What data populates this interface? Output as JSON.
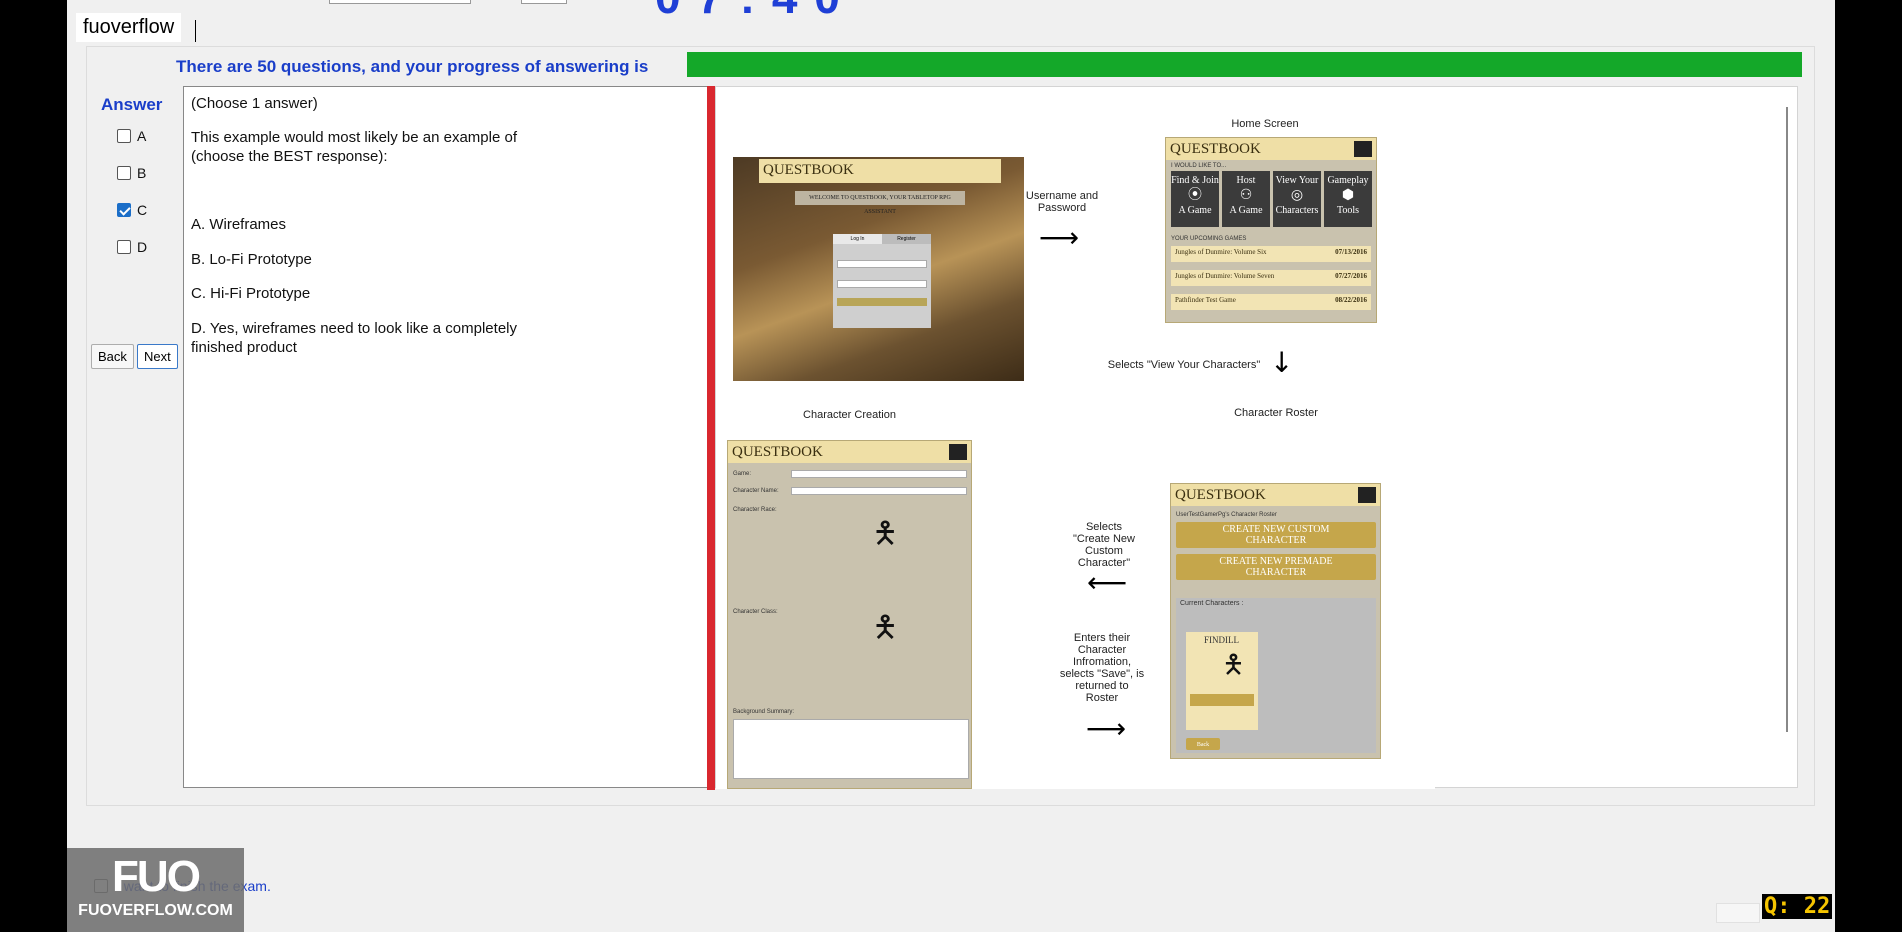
{
  "app": {
    "brand": "fuoverflow",
    "timer": "0 7 : 4 0"
  },
  "progress": {
    "text": "There are 50 questions, and your progress of answering is",
    "fraction": 1.0,
    "color": "#14a829"
  },
  "answer": {
    "title": "Answer",
    "options": [
      {
        "key": "A",
        "checked": false
      },
      {
        "key": "B",
        "checked": false
      },
      {
        "key": "C",
        "checked": true
      },
      {
        "key": "D",
        "checked": false
      }
    ],
    "back_label": "Back",
    "next_label": "Next"
  },
  "question": {
    "instruction": "(Choose 1 answer)",
    "stem_line1": "This example would most likely be an example of",
    "stem_line2": "(choose the BEST response):",
    "choices": [
      {
        "line1": "A.  Wireframes",
        "line2": ""
      },
      {
        "line1": "B.  Lo-Fi Prototype",
        "line2": ""
      },
      {
        "line1": "C.  Hi-Fi Prototype",
        "line2": ""
      },
      {
        "line1": "D.  Yes, wireframes need to look like a completely",
        "line2": "finished product"
      }
    ]
  },
  "figure": {
    "home_screen": "Home Screen",
    "username_password": "Username and Password",
    "selects_view": "Selects \"View Your Characters\"",
    "character_creation": "Character Creation",
    "character_roster": "Character Roster",
    "selects_create_l1": "Selects",
    "selects_create_l2": "\"Create New",
    "selects_create_l3": "Custom",
    "selects_create_l4": "Character\"",
    "enters_l1": "Enters their",
    "enters_l2": "Character",
    "enters_l3": "Infromation,",
    "enters_l4": "selects \"Save\", is",
    "enters_l5": "returned to",
    "enters_l6": "Roster",
    "questbook": "QUESTBOOK",
    "welcome": "WELCOME TO QUESTBOOK, YOUR TABLETOP RPG ASSISTANT",
    "log_in": "Log In",
    "register": "Register",
    "i_would_like": "I WOULD LIKE TO...",
    "tiles": [
      {
        "t1": "Find & Join",
        "t2": "A Game",
        "icon": "compass-icon",
        "glyph": "⦿"
      },
      {
        "t1": "Host",
        "t2": "A Game",
        "icon": "group-icon",
        "glyph": "⚇"
      },
      {
        "t1": "View Your",
        "t2": "Characters",
        "icon": "target-icon",
        "glyph": "◎"
      },
      {
        "t1": "Gameplay",
        "t2": "Tools",
        "icon": "dice-icon",
        "glyph": "⬢"
      }
    ],
    "upcoming": "YOUR UPCOMING GAMES",
    "games": [
      {
        "name": "Jungles of Dunmire: Volume Six",
        "date": "07/13/2016"
      },
      {
        "name": "Jungles of Dunmire: Volume Seven",
        "date": "07/27/2016"
      },
      {
        "name": "Pathfinder Test Game",
        "date": "08/22/2016"
      }
    ],
    "game_label": "Game:",
    "char_name_label": "Character Name:",
    "char_race_label": "Character Race:",
    "char_class_label": "Character Class:",
    "background_label": "Background Summary:",
    "roster_title": "UserTestGamerPg's Character Roster",
    "create_custom_l1": "CREATE NEW CUSTOM",
    "create_custom_l2": "CHARACTER",
    "create_premade_l1": "CREATE NEW PREMADE",
    "create_premade_l2": "CHARACTER",
    "current_chars": "Current Characters :",
    "char_card": "FINDILL",
    "back_small": "Back"
  },
  "finish": {
    "label": "I want to finish the exam."
  },
  "watermark": {
    "big": "FUO",
    "small": "FUOVERFLOW.COM"
  },
  "qcounter": "Q: 22"
}
